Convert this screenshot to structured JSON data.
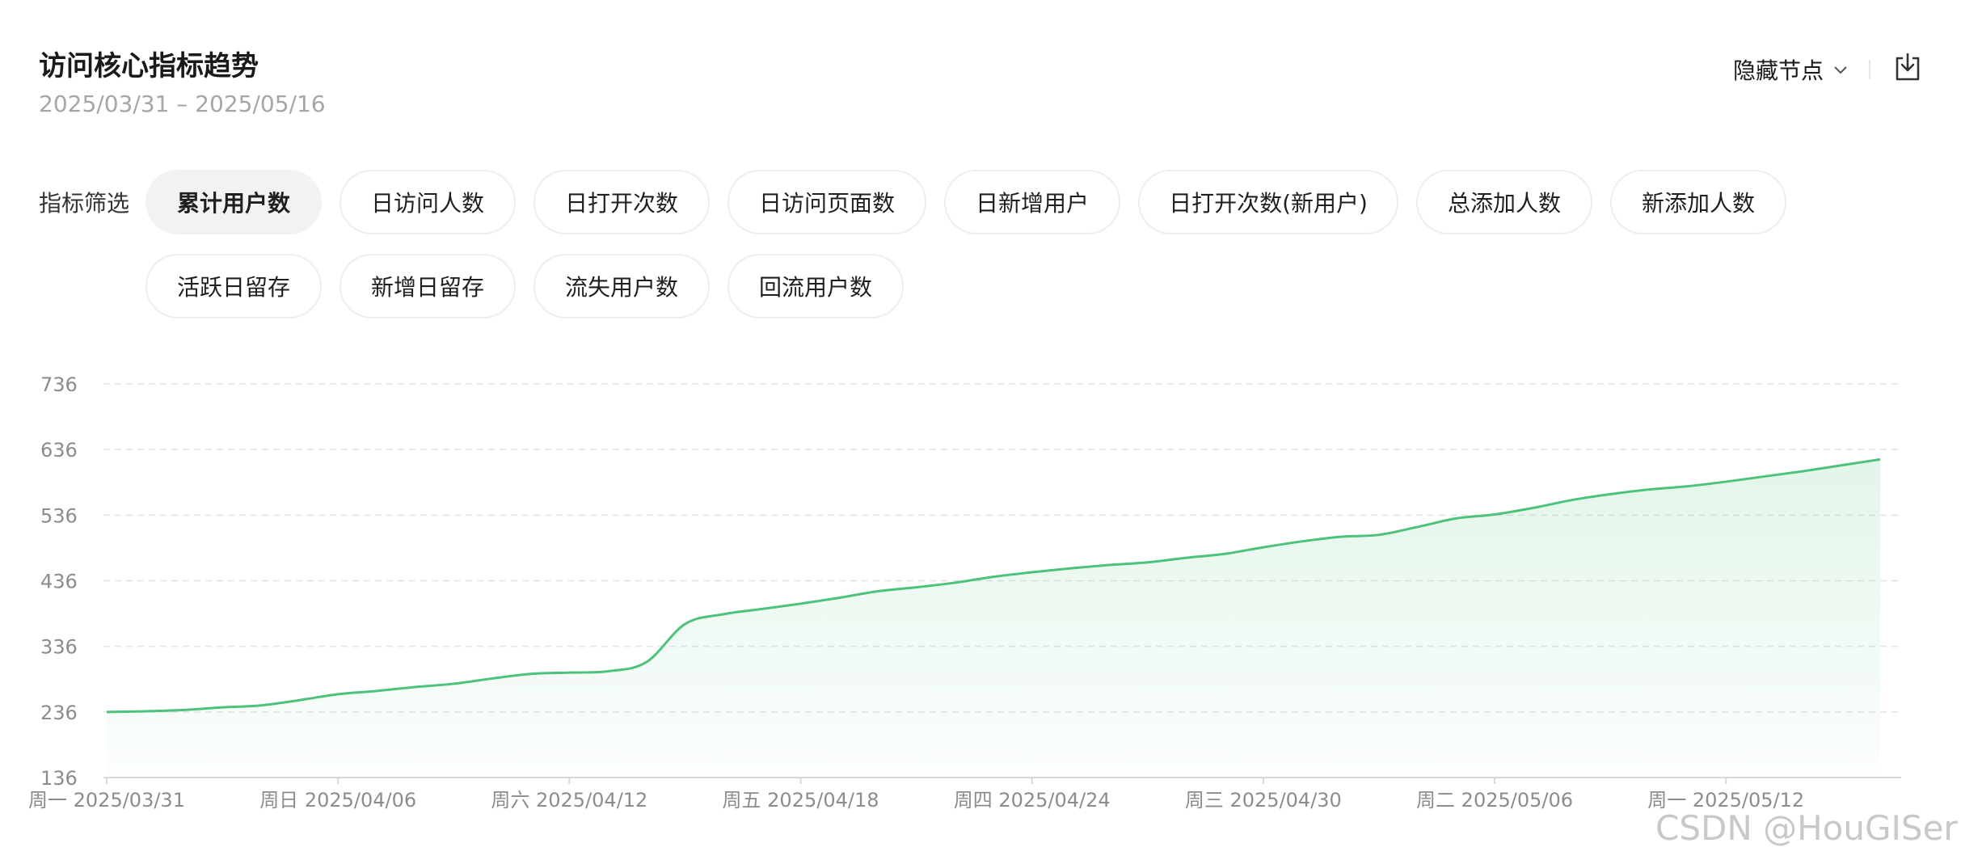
{
  "header": {
    "title": "访问核心指标趋势",
    "date_range": "2025/03/31 – 2025/05/16",
    "hide_nodes_label": "隐藏节点",
    "export_icon": "download-icon"
  },
  "filter": {
    "label": "指标筛选",
    "active_index": 0,
    "chips": [
      "累计用户数",
      "日访问人数",
      "日打开次数",
      "日访问页面数",
      "日新增用户",
      "日打开次数(新用户)",
      "总添加人数",
      "新添加人数",
      "活跃日留存",
      "新增日留存",
      "流失用户数",
      "回流用户数"
    ]
  },
  "watermark": "CSDN @HouGISer",
  "colors": {
    "line": "#4cc27a",
    "grid": "#e3e3e3",
    "axis": "#d9d9d9",
    "tick": "#8c8c8c"
  },
  "chart_data": {
    "type": "area",
    "title": "",
    "xlabel": "",
    "ylabel": "",
    "ylim": [
      136,
      736
    ],
    "yticks": [
      136,
      236,
      336,
      436,
      536,
      636,
      736
    ],
    "xtick_labels": [
      "周一 2025/03/31",
      "周日 2025/04/06",
      "周六 2025/04/12",
      "周五 2025/04/18",
      "周四 2025/04/24",
      "周三 2025/04/30",
      "周二 2025/05/06",
      "周一 2025/05/12"
    ],
    "xtick_indices": [
      0,
      6,
      12,
      18,
      24,
      30,
      36,
      42
    ],
    "grid": true,
    "legend": "none",
    "series": [
      {
        "x": [
          "2025/03/31",
          "2025/04/01",
          "2025/04/02",
          "2025/04/03",
          "2025/04/04",
          "2025/04/05",
          "2025/04/06",
          "2025/04/07",
          "2025/04/08",
          "2025/04/09",
          "2025/04/10",
          "2025/04/11",
          "2025/04/12",
          "2025/04/13",
          "2025/04/14",
          "2025/04/15",
          "2025/04/16",
          "2025/04/17",
          "2025/04/18",
          "2025/04/19",
          "2025/04/20",
          "2025/04/21",
          "2025/04/22",
          "2025/04/23",
          "2025/04/24",
          "2025/04/25",
          "2025/04/26",
          "2025/04/27",
          "2025/04/28",
          "2025/04/29",
          "2025/04/30",
          "2025/05/01",
          "2025/05/02",
          "2025/05/03",
          "2025/05/04",
          "2025/05/05",
          "2025/05/06",
          "2025/05/07",
          "2025/05/08",
          "2025/05/09",
          "2025/05/10",
          "2025/05/11",
          "2025/05/12",
          "2025/05/13",
          "2025/05/14",
          "2025/05/15",
          "2025/05/16"
        ],
        "values": [
          236,
          237,
          239,
          243,
          246,
          254,
          263,
          268,
          274,
          279,
          287,
          294,
          296,
          298,
          312,
          370,
          385,
          393,
          401,
          410,
          420,
          426,
          433,
          442,
          449,
          455,
          460,
          464,
          471,
          477,
          487,
          496,
          503,
          506,
          518,
          531,
          537,
          547,
          559,
          568,
          575,
          580,
          587,
          595,
          603,
          612,
          621
        ]
      }
    ]
  }
}
